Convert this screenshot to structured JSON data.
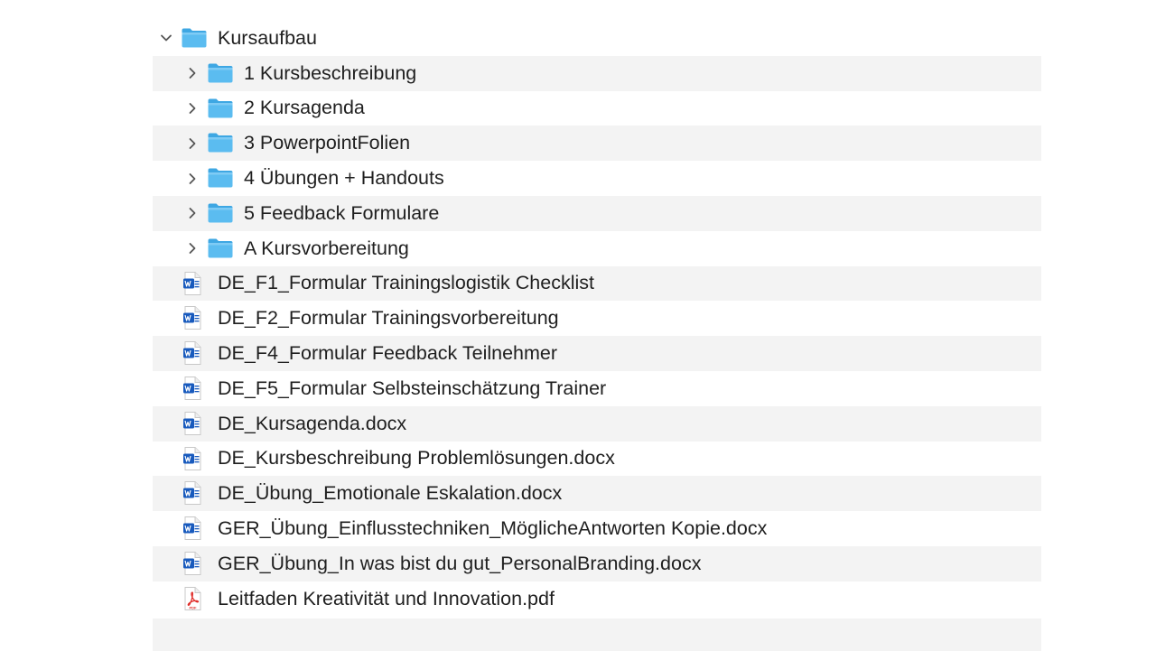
{
  "tree": {
    "root": {
      "label": "Kursaufbau",
      "icon": "folder-icon",
      "expanded": true
    },
    "items": [
      {
        "type": "folder",
        "label": "1 Kursbeschreibung",
        "icon": "folder-icon",
        "expanded": false
      },
      {
        "type": "folder",
        "label": "2 Kursagenda",
        "icon": "folder-icon",
        "expanded": false
      },
      {
        "type": "folder",
        "label": "3 PowerpointFolien",
        "icon": "folder-icon",
        "expanded": false
      },
      {
        "type": "folder",
        "label": "4 Übungen + Handouts",
        "icon": "folder-icon",
        "expanded": false
      },
      {
        "type": "folder",
        "label": "5 Feedback Formulare",
        "icon": "folder-icon",
        "expanded": false
      },
      {
        "type": "folder",
        "label": "A Kursvorbereitung",
        "icon": "folder-icon",
        "expanded": false
      },
      {
        "type": "file",
        "label": "DE_F1_Formular Trainingslogistik Checklist",
        "icon": "word-doc-icon"
      },
      {
        "type": "file",
        "label": "DE_F2_Formular Trainingsvorbereitung",
        "icon": "word-doc-icon"
      },
      {
        "type": "file",
        "label": "DE_F4_Formular Feedback Teilnehmer",
        "icon": "word-doc-icon"
      },
      {
        "type": "file",
        "label": "DE_F5_Formular Selbsteinschätzung Trainer",
        "icon": "word-doc-icon"
      },
      {
        "type": "file",
        "label": "DE_Kursagenda.docx",
        "icon": "word-doc-icon"
      },
      {
        "type": "file",
        "label": "DE_Kursbeschreibung Problemlösungen.docx",
        "icon": "word-doc-icon"
      },
      {
        "type": "file",
        "label": "DE_Übung_Emotionale Eskalation.docx",
        "icon": "word-doc-icon"
      },
      {
        "type": "file",
        "label": "GER_Übung_Einflusstechniken_MöglicheAntworten Kopie.docx",
        "icon": "word-doc-icon"
      },
      {
        "type": "file",
        "label": "GER_Übung_In was bist du gut_PersonalBranding.docx",
        "icon": "word-doc-icon"
      },
      {
        "type": "file",
        "label": "Leitfaden Kreativität und Innovation.pdf",
        "icon": "pdf-icon"
      }
    ]
  },
  "colors": {
    "row_alt_bg": "#f3f3f3",
    "folder_blue": "#5bbcf0",
    "word_blue": "#185abd",
    "pdf_red": "#e0302c",
    "text": "#1f1f1f"
  }
}
